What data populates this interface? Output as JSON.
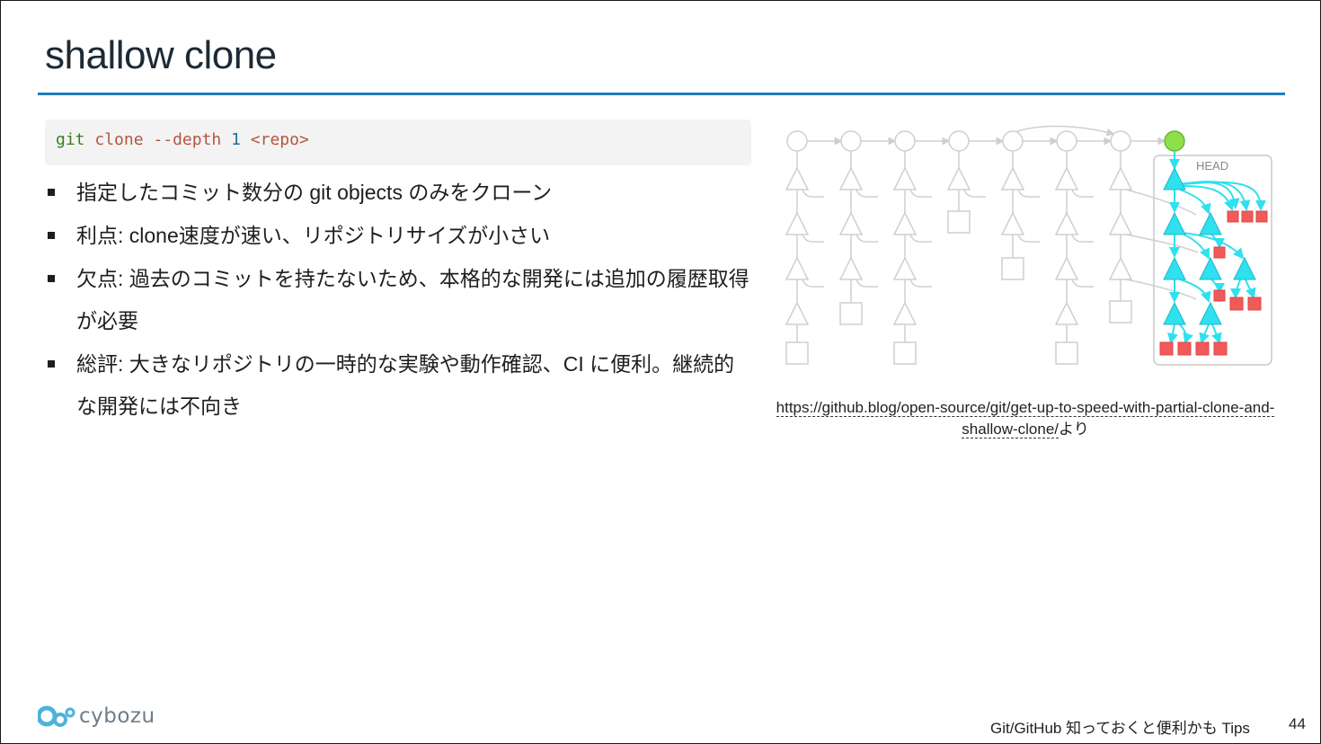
{
  "slide": {
    "title": "shallow clone",
    "code": {
      "git": "git",
      "clone": "clone",
      "option": "--depth",
      "number": "1",
      "argument": "<repo>"
    },
    "bullets": [
      "指定したコミット数分の git objects のみをクローン",
      "利点: clone速度が速い、リポジトリサイズが小さい",
      "欠点: 過去のコミットを持たないため、本格的な開発には追加の履歴取得が必要",
      "総評: 大きなリポジトリの一時的な実験や動作確認、CI に便利。継続的な開発には不向き"
    ],
    "diagram": {
      "head_label": "HEAD",
      "colors": {
        "commit_green": "#8ee04a",
        "tree_cyan": "#2fe0ee",
        "blob_red": "#f25a5a",
        "faded_gray": "#cfcfcf"
      }
    },
    "caption": {
      "link_text": "https://github.blog/open-source/git/get-up-to-speed-with-partial-clone-and-shallow-clone/",
      "suffix": "より"
    }
  },
  "footer": {
    "logo_text": "cybozu",
    "deck_title": "Git/GitHub 知っておくと便利かも Tips",
    "page_number": "44"
  },
  "theme": {
    "accent": "#1f7abf",
    "title_color": "#1d2a36",
    "code_background": "#f3f3f3"
  }
}
